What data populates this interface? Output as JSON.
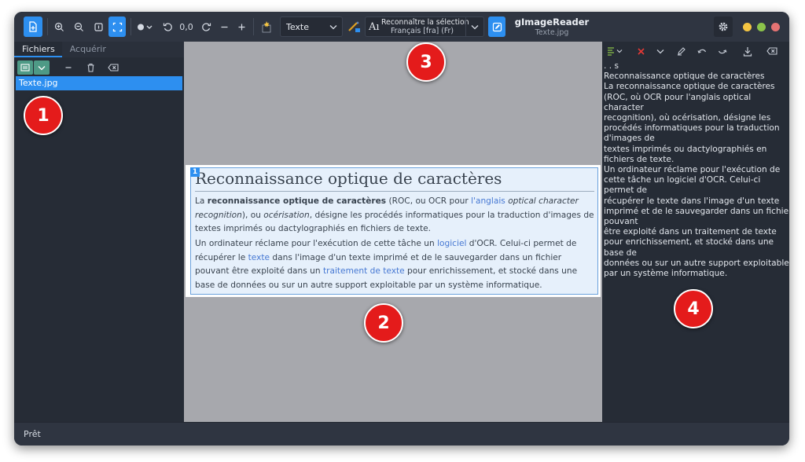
{
  "window": {
    "title": "gImageReader",
    "subtitle": "Texte.jpg"
  },
  "toolbar": {
    "rotation_value": "0,0",
    "output_mode": "Texte",
    "recognize_label": "Reconnaître la sélection",
    "recognize_language": "Français [fra] (Fr)",
    "accent_color": "#2d8ff0",
    "traffic_lights": [
      "#f5c542",
      "#8bc34a",
      "#e57373"
    ]
  },
  "sources": {
    "tabs": [
      "Fichiers",
      "Acquérir"
    ],
    "files": [
      "Texte.jpg"
    ]
  },
  "document": {
    "selection_number": "1",
    "title": "Reconnaissance optique de caractères",
    "p1": {
      "s1": "La ",
      "bold": "reconnaissance optique de caractères",
      "s2": " (ROC, ou OCR pour ",
      "link1": "l'anglais",
      "italic1": "optical character recognition",
      "s3": "), ou ",
      "italic2": "océrisation",
      "s4": ", désigne les procédés informatiques pour la traduction d'images de textes imprimés ou dactylographiés en fichiers de texte."
    },
    "p2": {
      "s1": "Un ordinateur réclame pour l'exécution de cette tâche un ",
      "link1": "logiciel",
      "s2": " d'OCR. Celui-ci permet de récupérer le ",
      "link2": "texte",
      "s3": " dans l'image d'un texte imprimé et de le sauvegarder dans un fichier pouvant être exploité dans un ",
      "link3": "traitement de texte",
      "s4": " pour enrichissement, et stocké dans une base de données ou sur un autre support exploitable par un système informatique."
    }
  },
  "output": {
    "lines": [
      ". . s",
      "Reconnaissance optique de caractères",
      "La reconnaissance optique de caractères",
      "(ROC, où OCR pour l'anglais optical",
      "character",
      "recognition), où océrisation, désigne les",
      "procédés informatiques pour la traduction",
      "d'images de",
      "textes imprimés ou dactylographiés en",
      "fichiers de texte.",
      "Un ordinateur réclame pour l'exécution de",
      "cette tâche un logiciel d'OCR. Celui-ci",
      "permet de",
      "récupérer le texte dans l'image d'un texte",
      "imprimé et de le sauvegarder dans un fichier",
      "pouvant",
      "être exploité dans un traitement de texte",
      "pour enrichissement, et stocké dans une",
      "base de",
      "données ou sur un autre support exploitable",
      "par un système informatique."
    ]
  },
  "status": "Prêt",
  "badges": [
    "1",
    "2",
    "3",
    "4"
  ]
}
